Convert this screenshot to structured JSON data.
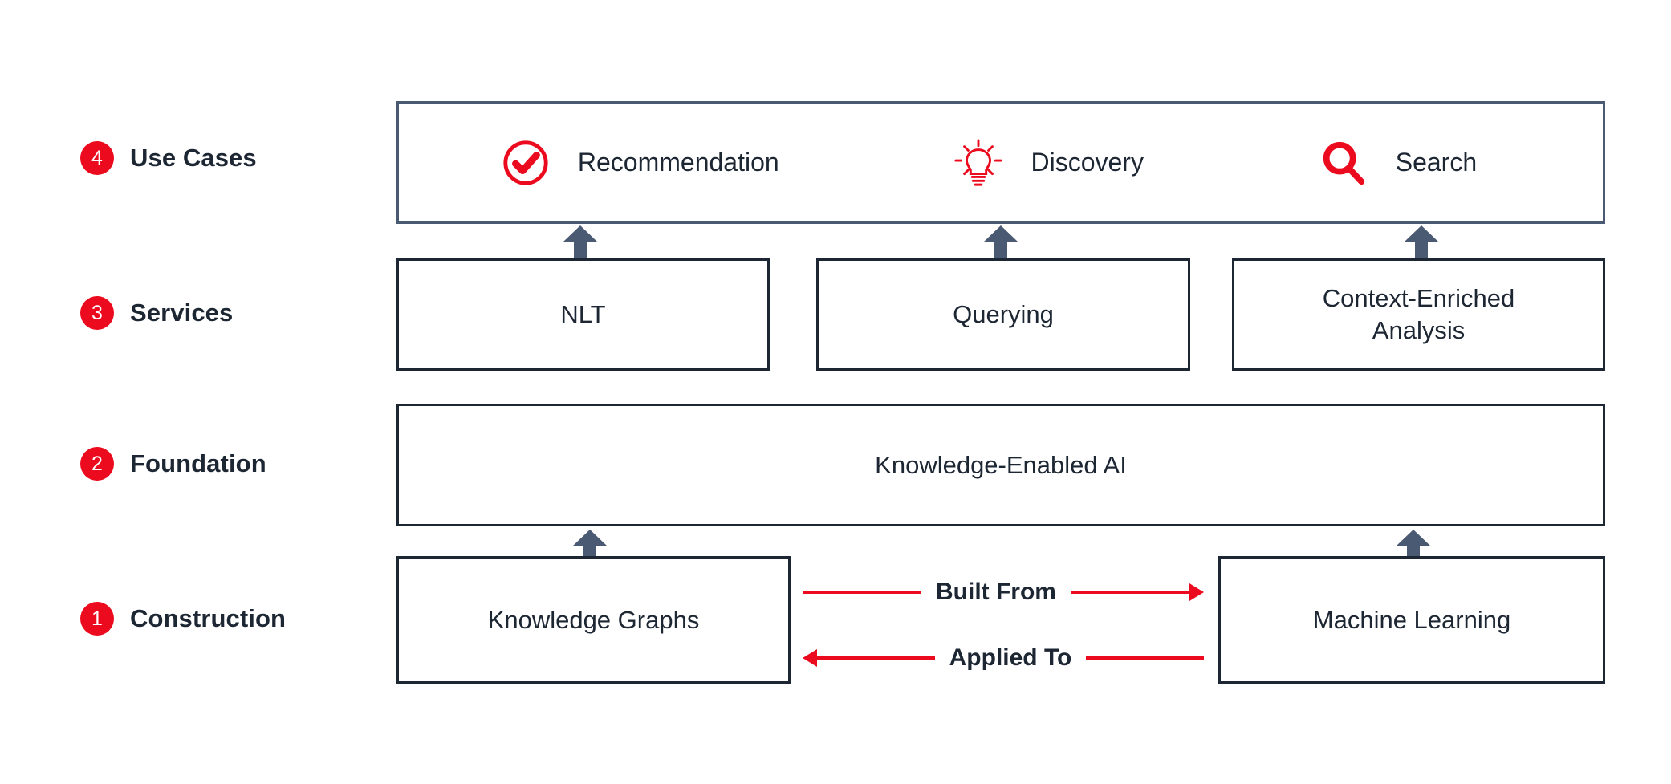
{
  "colors": {
    "accent_red": "#eb0a1e",
    "slate_border": "#4a5a72",
    "dark_border": "#1d2633",
    "text_dark": "#1d2633",
    "background": "#ffffff"
  },
  "rows": [
    {
      "number": "4",
      "label": "Use Cases"
    },
    {
      "number": "3",
      "label": "Services"
    },
    {
      "number": "2",
      "label": "Foundation"
    },
    {
      "number": "1",
      "label": "Construction"
    }
  ],
  "use_cases": {
    "items": [
      {
        "icon": "check-circle-icon",
        "label": "Recommendation"
      },
      {
        "icon": "lightbulb-icon",
        "label": "Discovery"
      },
      {
        "icon": "magnifier-icon",
        "label": "Search"
      }
    ]
  },
  "services": {
    "items": [
      {
        "label": "NLT"
      },
      {
        "label": "Querying"
      },
      {
        "label_line1": "Context-Enriched",
        "label_line2": "Analysis"
      }
    ]
  },
  "foundation": {
    "label": "Knowledge-Enabled AI"
  },
  "construction": {
    "left_box": "Knowledge Graphs",
    "right_box": "Machine Learning",
    "relations": [
      {
        "label": "Built From",
        "direction": "right"
      },
      {
        "label": "Applied To",
        "direction": "left"
      }
    ]
  }
}
